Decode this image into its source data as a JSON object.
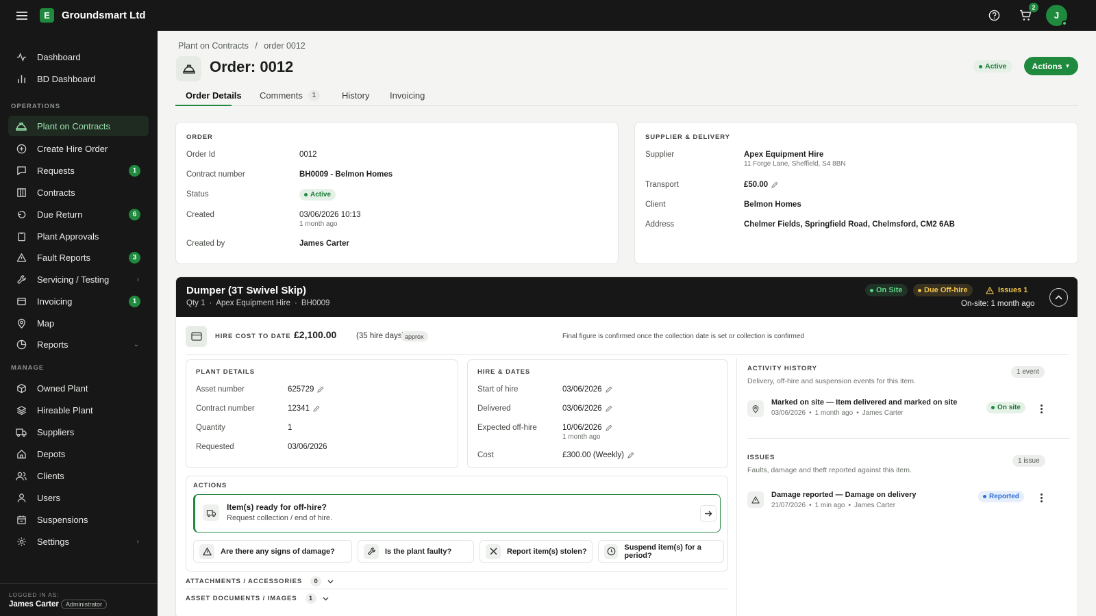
{
  "app": {
    "company": "Groundsmart Ltd",
    "logo_letter": "E",
    "cart_count": "2",
    "avatar_initial": "J"
  },
  "sidebar": {
    "top_items": [
      {
        "label": "Dashboard",
        "icon": "activity-icon"
      },
      {
        "label": "BD Dashboard",
        "icon": "bar-chart-icon"
      }
    ],
    "operations_label": "OPERATIONS",
    "operations": [
      {
        "label": "Plant on Contracts",
        "icon": "hard-hat-icon"
      },
      {
        "label": "Create Hire Order",
        "icon": "plus-circle-icon"
      },
      {
        "label": "Requests",
        "icon": "message-icon",
        "badge": "1"
      },
      {
        "label": "Contracts",
        "icon": "building-icon"
      },
      {
        "label": "Due Return",
        "icon": "undo-icon",
        "badge": "6"
      },
      {
        "label": "Plant Approvals",
        "icon": "clipboard-icon"
      },
      {
        "label": "Fault Reports",
        "icon": "warning-icon",
        "badge": "3"
      },
      {
        "label": "Servicing / Testing",
        "icon": "wrench-icon"
      },
      {
        "label": "Invoicing",
        "icon": "invoice-icon",
        "badge": "1"
      },
      {
        "label": "Map",
        "icon": "map-pin-icon"
      },
      {
        "label": "Reports",
        "icon": "pie-chart-icon"
      }
    ],
    "manage_label": "MANAGE",
    "manage": [
      {
        "label": "Owned Plant",
        "icon": "package-icon"
      },
      {
        "label": "Hireable Plant",
        "icon": "layers-icon"
      },
      {
        "label": "Suppliers",
        "icon": "truck-icon"
      },
      {
        "label": "Depots",
        "icon": "home-icon"
      },
      {
        "label": "Clients",
        "icon": "users-icon"
      },
      {
        "label": "Users",
        "icon": "user-icon"
      },
      {
        "label": "Suspensions",
        "icon": "calendar-icon"
      },
      {
        "label": "Settings",
        "icon": "gear-icon"
      }
    ],
    "logged_in_label": "LOGGED IN AS:",
    "user_name": "James Carter",
    "user_role": "Administrator"
  },
  "breadcrumb": {
    "parent": "Plant on Contracts",
    "separator": "/",
    "current": "order 0012"
  },
  "page": {
    "title": "Order: 0012",
    "status": "Active",
    "actions_label": "Actions"
  },
  "tabs": [
    {
      "label": "Order Details"
    },
    {
      "label": "Comments",
      "badge": "1"
    },
    {
      "label": "History"
    },
    {
      "label": "Invoicing"
    }
  ],
  "order": {
    "section_label": "ORDER",
    "order_id_label": "Order Id",
    "order_id": "0012",
    "contract_label": "Contract number",
    "contract": "BH0009 - Belmon Homes",
    "status_label": "Status",
    "status": "Active",
    "created_label": "Created",
    "created": "03/06/2026 10:13",
    "created_ago": "1 month ago",
    "created_by_label": "Created by",
    "created_by": "James Carter"
  },
  "supplier": {
    "section_label": "SUPPLIER & DELIVERY",
    "supplier_label": "Supplier",
    "supplier": "Apex Equipment Hire",
    "supplier_address": "11 Forge Lane, Sheffield, S4 8BN",
    "transport_label": "Transport",
    "transport": "£50.00",
    "client_label": "Client",
    "client": "Belmon Homes",
    "address_label": "Address",
    "address": "Chelmer Fields, Springfield Road, Chelmsford, CM2 6AB"
  },
  "item": {
    "title": "Dumper (3T Swivel Skip)",
    "qty": "Qty 1",
    "supplier": "Apex Equipment Hire",
    "contract": "BH0009",
    "badge_onsite": "On Site",
    "badge_due": "Due Off-hire",
    "badge_issues": "Issues 1",
    "onsite_since": "On-site: 1 month ago",
    "hire_cost_label": "HIRE COST TO DATE",
    "hire_cost": "£2,100.00",
    "hire_days": "(35 hire days)",
    "approx": "approx",
    "hire_note": "Final figure is confirmed once the collection date is set or collection is confirmed"
  },
  "plant_details": {
    "label": "PLANT DETAILS",
    "asset_label": "Asset number",
    "asset": "625729",
    "contract_label": "Contract number",
    "contract": "12341",
    "quantity_label": "Quantity",
    "quantity": "1",
    "requested_label": "Requested",
    "requested": "03/06/2026"
  },
  "hire_dates": {
    "label": "HIRE & DATES",
    "start_label": "Start of hire",
    "start": "03/06/2026",
    "delivered_label": "Delivered",
    "delivered": "03/06/2026",
    "expected_label": "Expected off-hire",
    "expected": "10/06/2026",
    "expected_ago": "1 month ago",
    "cost_label": "Cost",
    "cost": "£300.00 (Weekly)"
  },
  "actions": {
    "label": "ACTIONS",
    "offhire_title": "Item(s) ready for off-hire?",
    "offhire_sub": "Request collection / end of hire.",
    "damage": "Are there any signs of damage?",
    "faulty": "Is the plant faulty?",
    "stolen": "Report item(s) stolen?",
    "suspend": "Suspend item(s) for a period?"
  },
  "attachments": {
    "label": "ATTACHMENTS / ACCESSORIES",
    "count": "0"
  },
  "documents": {
    "label": "ASSET DOCUMENTS / IMAGES",
    "count": "1"
  },
  "activity": {
    "label": "ACTIVITY HISTORY",
    "count": "1 event",
    "desc": "Delivery, off-hire and suspension events for this item.",
    "event_title": "Marked on site — Item delivered and marked on site",
    "event_date": "03/06/2026",
    "event_ago": "1 month ago",
    "event_user": "James Carter",
    "event_badge": "On site"
  },
  "issues": {
    "label": "ISSUES",
    "count": "1 issue",
    "desc": "Faults, damage and theft reported against this item.",
    "issue_title": "Damage reported — Damage on delivery",
    "issue_date": "21/07/2026",
    "issue_ago": "1 min ago",
    "issue_user": "James Carter",
    "issue_badge": "Reported"
  },
  "colors": {
    "accent": "#1f8a3d",
    "topbar": "#161716",
    "due": "#e3b23c",
    "reported": "#2f6fd6"
  }
}
